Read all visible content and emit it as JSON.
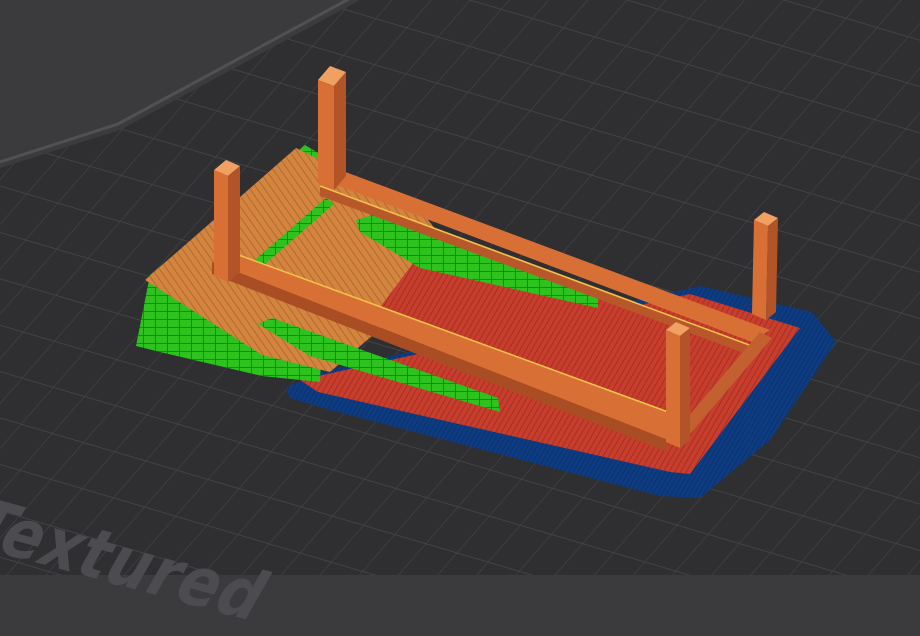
{
  "viewport": {
    "bed_label": "Textured"
  },
  "colors": {
    "background": "#3b3b3e",
    "bed_plate": "#2f2f32",
    "bed_grid": "#47474b",
    "bed_label": "#4b4b50",
    "skirt": "#0e3f86",
    "first_layer": "#c83d2c",
    "internal_infill": "#b83a33",
    "perimeter": "#d87035",
    "ramp_infill": "#c9823f",
    "support": "#2ec21f"
  },
  "legend_features": [
    "skirt-brim",
    "solid-infill",
    "internal-infill",
    "perimeter",
    "support-material"
  ]
}
